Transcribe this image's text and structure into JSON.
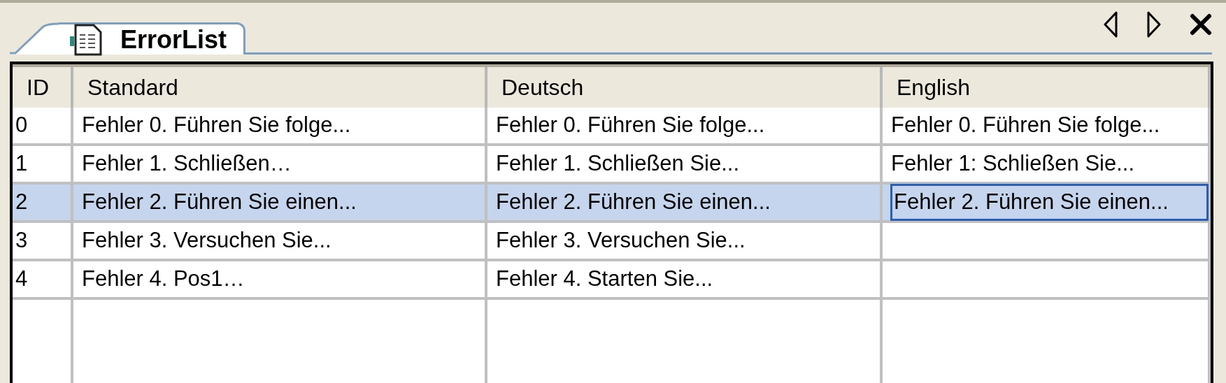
{
  "tab": {
    "label": "ErrorList",
    "selected": true
  },
  "table": {
    "columns": [
      "ID",
      "Standard",
      "Deutsch",
      "English"
    ],
    "rows": [
      {
        "selected": false,
        "cells": [
          {
            "text": "0",
            "focused": false
          },
          {
            "text": "Fehler 0. Führen Sie folge...",
            "focused": false
          },
          {
            "text": "Fehler 0. Führen Sie folge...",
            "focused": false
          },
          {
            "text": "Fehler 0. Führen Sie folge...",
            "focused": false
          }
        ]
      },
      {
        "selected": false,
        "cells": [
          {
            "text": "1",
            "focused": false
          },
          {
            "text": "Fehler 1. Schließen…",
            "focused": false
          },
          {
            "text": "Fehler 1. Schließen Sie...",
            "focused": false
          },
          {
            "text": "Fehler 1: Schließen Sie...",
            "focused": false
          }
        ]
      },
      {
        "selected": true,
        "cells": [
          {
            "text": "2",
            "focused": false
          },
          {
            "text": "Fehler 2. Führen Sie einen...",
            "focused": false
          },
          {
            "text": "Fehler 2. Führen Sie einen...",
            "focused": false
          },
          {
            "text": "Fehler 2. Führen Sie einen...",
            "focused": true
          }
        ]
      },
      {
        "selected": false,
        "cells": [
          {
            "text": "3",
            "focused": false
          },
          {
            "text": "Fehler 3. Versuchen Sie...",
            "focused": false
          },
          {
            "text": "Fehler 3. Versuchen Sie...",
            "focused": false
          }
        ]
      },
      {
        "selected": false,
        "cells": [
          {
            "text": "4",
            "focused": false
          },
          {
            "text": "Fehler 4. Pos1…",
            "focused": false
          },
          {
            "text": "Fehler 4. Starten Sie...",
            "focused": false
          }
        ]
      }
    ]
  }
}
